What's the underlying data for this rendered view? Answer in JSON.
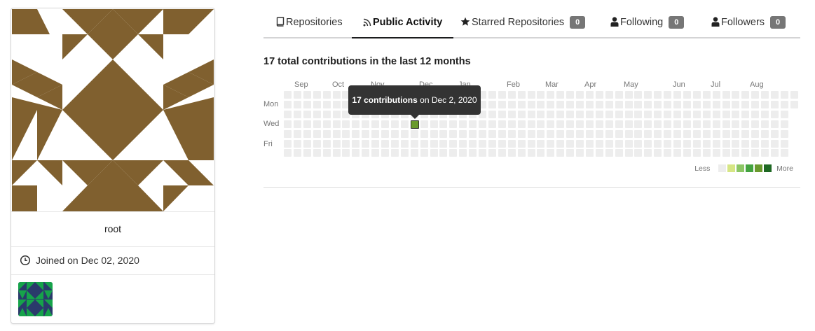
{
  "profile": {
    "username": "root",
    "joined": "Joined on Dec 02, 2020",
    "colors": {
      "avatar_pattern": "#80602f",
      "org_dark": "#2a3a6b",
      "org_green": "#16a34a"
    }
  },
  "tabs": [
    {
      "label": "Repositories",
      "icon": "repo-icon"
    },
    {
      "label": "Public Activity",
      "icon": "rss-icon",
      "active": true
    },
    {
      "label": "Starred Repositories",
      "icon": "star-icon",
      "count": "0"
    },
    {
      "label": "Following",
      "icon": "person-icon",
      "count": "0"
    },
    {
      "label": "Followers",
      "icon": "person-icon",
      "count": "0"
    }
  ],
  "contributions": {
    "title": "17 total contributions in the last 12 months",
    "months": [
      "Sep",
      "Oct",
      "Nov",
      "Dec",
      "Jan",
      "Feb",
      "Mar",
      "Apr",
      "May",
      "Jun",
      "Jul",
      "Aug"
    ],
    "days": [
      "Mon",
      "Wed",
      "Fri"
    ],
    "legend": {
      "less": "Less",
      "more": "More",
      "colors": [
        "#ededed",
        "#d6e685",
        "#8cc665",
        "#44a340",
        "#1e6823"
      ]
    },
    "tooltip": {
      "count": "17 contributions",
      "date": "on Dec 2, 2020"
    },
    "highlight_color": "#6a9a2e"
  }
}
